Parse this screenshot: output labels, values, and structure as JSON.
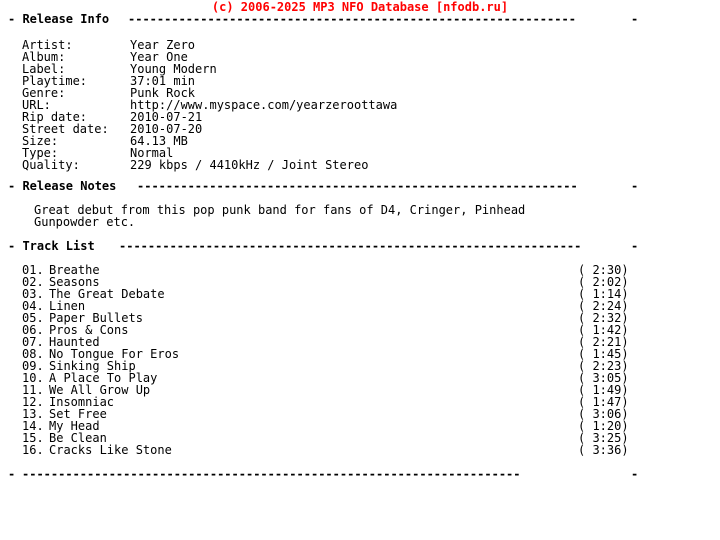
{
  "page": {
    "background_color": "#ffffff",
    "text_color": "#000000",
    "accent_color": "#ff0000",
    "copyright": "(c) 2006-2025 MP3 NFO Database [nfodb.ru]"
  },
  "sections": {
    "release_info": {
      "heading": "- Release Info ",
      "rule": "--------------------------------------------------------------",
      "rule_end": "-",
      "fields": [
        {
          "label": "Artist:",
          "value": "Year Zero"
        },
        {
          "label": "Album:",
          "value": "Year One"
        },
        {
          "label": "Label:",
          "value": "Young Modern"
        },
        {
          "label": "Playtime:",
          "value": "37:01 min"
        },
        {
          "label": "Genre:",
          "value": "Punk Rock"
        },
        {
          "label": "URL:",
          "value": "http://www.myspace.com/yearzeroottawa"
        },
        {
          "label": "Rip date:",
          "value": "2010-07-21"
        },
        {
          "label": "Street date:",
          "value": "2010-07-20"
        },
        {
          "label": "Size:",
          "value": "64.13 MB"
        },
        {
          "label": "Type:",
          "value": "Normal"
        },
        {
          "label": "Quality:",
          "value": "229 kbps / 4410kHz / Joint Stereo"
        }
      ]
    },
    "release_notes": {
      "heading": "- Release Notes ",
      "rule": "-------------------------------------------------------------",
      "rule_end": "-",
      "lines": [
        "Great debut from this pop punk band for fans of D4, Cringer, Pinhead",
        "Gunpowder etc."
      ]
    },
    "track_list": {
      "heading": "- Track List ",
      "rule": "----------------------------------------------------------------",
      "rule_end": "-",
      "tracks": [
        {
          "num": "01.",
          "title": "Breathe",
          "time": "( 2:30)"
        },
        {
          "num": "02.",
          "title": "Seasons",
          "time": "( 2:02)"
        },
        {
          "num": "03.",
          "title": "The Great Debate",
          "time": "( 1:14)"
        },
        {
          "num": "04.",
          "title": "Linen",
          "time": "( 2:24)"
        },
        {
          "num": "05.",
          "title": "Paper Bullets",
          "time": "( 2:32)"
        },
        {
          "num": "06.",
          "title": "Pros & Cons",
          "time": "( 1:42)"
        },
        {
          "num": "07.",
          "title": "Haunted",
          "time": "( 2:21)"
        },
        {
          "num": "08.",
          "title": "No Tongue For Eros",
          "time": "( 1:45)"
        },
        {
          "num": "09.",
          "title": "Sinking Ship",
          "time": "( 2:23)"
        },
        {
          "num": "10.",
          "title": "A Place To Play",
          "time": "( 3:05)"
        },
        {
          "num": "11.",
          "title": "We All Grow Up",
          "time": "( 1:49)"
        },
        {
          "num": "12.",
          "title": "Insomniac",
          "time": "( 1:47)"
        },
        {
          "num": "13.",
          "title": "Set Free",
          "time": "( 3:06)"
        },
        {
          "num": "14.",
          "title": "My Head",
          "time": "( 1:20)"
        },
        {
          "num": "15.",
          "title": "Be Clean",
          "time": "( 3:25)"
        },
        {
          "num": "16.",
          "title": "Cracks Like Stone",
          "time": "( 3:36)"
        }
      ]
    },
    "footer": {
      "rule_start": "-",
      "rule": "---------------------------------------------------------------------",
      "rule_end": "-"
    }
  }
}
